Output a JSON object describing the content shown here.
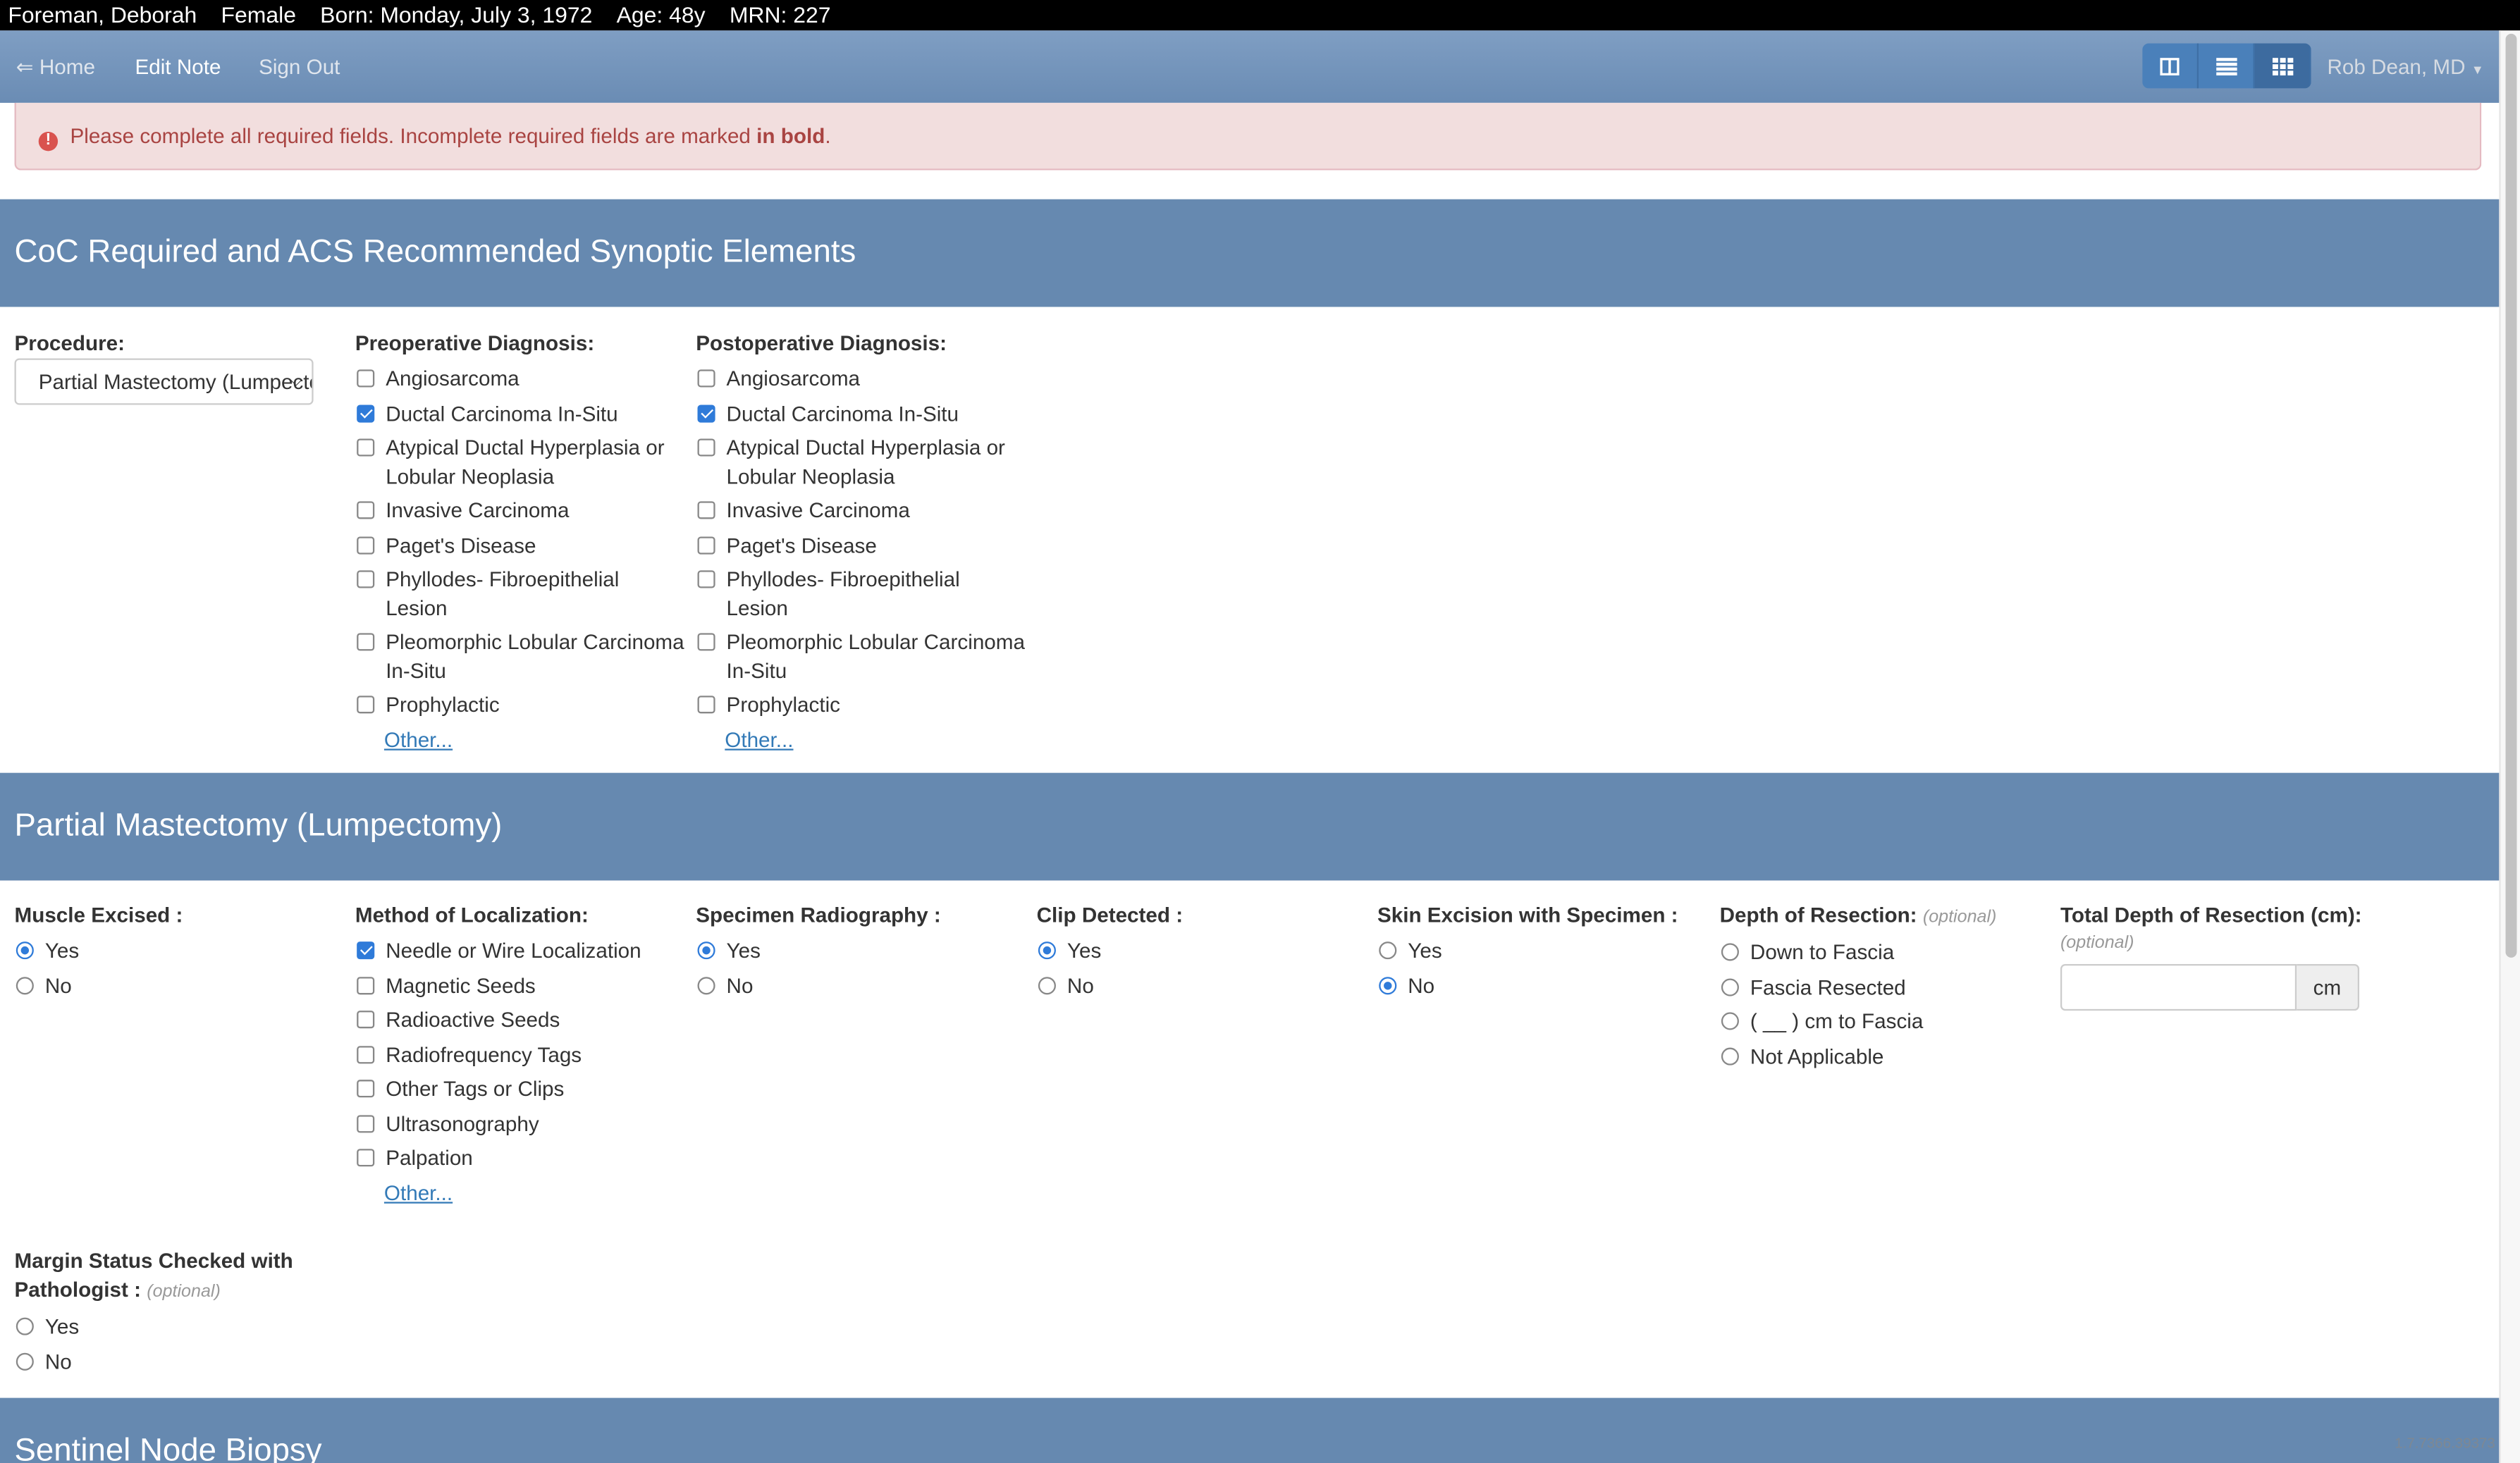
{
  "patient": {
    "name": "Foreman, Deborah",
    "sex": "Female",
    "born": "Born: Monday, July 3, 1972",
    "age": "Age: 48y",
    "mrn": "MRN: 227"
  },
  "nav": {
    "home": "⇐ Home",
    "edit_note": "Edit Note",
    "sign_out": "Sign Out",
    "user": "Rob Dean, MD",
    "views": [
      "two-column-icon",
      "list-icon",
      "grid-icon"
    ],
    "selected_view": "grid-icon"
  },
  "alert": {
    "text": "Please complete all required fields. Incomplete required fields are marked ",
    "bold": "in bold",
    "end": "."
  },
  "colors": {
    "section": "#6689b0",
    "nav": "#7496bd",
    "accent": "#2f7bd9",
    "alert_text": "#a94442"
  },
  "sections": [
    {
      "title": "CoC Required and ACS Recommended Synoptic Elements"
    },
    {
      "title": "Partial Mastectomy (Lumpectomy)"
    },
    {
      "title": "Sentinel Node Biopsy"
    }
  ],
  "procedure": {
    "label": "Procedure:",
    "value": "Partial Mastectomy (Lumpectomy)"
  },
  "fields": [
    {
      "label": "Preoperative Diagnosis:",
      "type": "checkbox",
      "options": [
        {
          "label": "Angiosarcoma",
          "checked": false
        },
        {
          "label": "Ductal Carcinoma In-Situ",
          "checked": true
        },
        {
          "label": "Atypical Ductal Hyperplasia or Lobular Neoplasia",
          "checked": false
        },
        {
          "label": "Invasive Carcinoma",
          "checked": false
        },
        {
          "label": "Paget's Disease",
          "checked": false
        },
        {
          "label": "Phyllodes- Fibroepithelial Lesion",
          "checked": false
        },
        {
          "label": "Pleomorphic Lobular Carcinoma In-Situ",
          "checked": false
        },
        {
          "label": "Prophylactic",
          "checked": false
        }
      ],
      "other": "Other..."
    },
    {
      "label": "Postoperative Diagnosis:",
      "type": "checkbox",
      "options": [
        {
          "label": "Angiosarcoma",
          "checked": false
        },
        {
          "label": "Ductal Carcinoma In-Situ",
          "checked": true
        },
        {
          "label": "Atypical Ductal Hyperplasia or Lobular Neoplasia",
          "checked": false
        },
        {
          "label": "Invasive Carcinoma",
          "checked": false
        },
        {
          "label": "Paget's Disease",
          "checked": false
        },
        {
          "label": "Phyllodes- Fibroepithelial Lesion",
          "checked": false
        },
        {
          "label": "Pleomorphic Lobular Carcinoma In-Situ",
          "checked": false
        },
        {
          "label": "Prophylactic",
          "checked": false
        }
      ],
      "other": "Other..."
    },
    {
      "label": "Muscle Excised :",
      "type": "radio",
      "options": [
        {
          "label": "Yes",
          "checked": true
        },
        {
          "label": "No",
          "checked": false
        }
      ]
    },
    {
      "label": "Method of Localization:",
      "type": "checkbox",
      "options": [
        {
          "label": "Needle or Wire Localization",
          "checked": true
        },
        {
          "label": "Magnetic Seeds",
          "checked": false
        },
        {
          "label": "Radioactive Seeds",
          "checked": false
        },
        {
          "label": "Radiofrequency Tags",
          "checked": false
        },
        {
          "label": "Other Tags or Clips",
          "checked": false
        },
        {
          "label": "Ultrasonography",
          "checked": false
        },
        {
          "label": "Palpation",
          "checked": false
        }
      ],
      "other": "Other..."
    },
    {
      "label": "Specimen Radiography :",
      "type": "radio",
      "options": [
        {
          "label": "Yes",
          "checked": true
        },
        {
          "label": "No",
          "checked": false
        }
      ]
    },
    {
      "label": "Clip Detected :",
      "type": "radio",
      "options": [
        {
          "label": "Yes",
          "checked": true
        },
        {
          "label": "No",
          "checked": false
        }
      ]
    },
    {
      "label": "Skin Excision with Specimen :",
      "type": "radio",
      "options": [
        {
          "label": "Yes",
          "checked": false
        },
        {
          "label": "No",
          "checked": true
        }
      ]
    },
    {
      "label": "Depth of Resection:",
      "optional": "(optional)",
      "type": "radio",
      "options": [
        {
          "label": "Down to Fascia",
          "checked": false
        },
        {
          "label": "Fascia Resected",
          "checked": false
        },
        {
          "label": "( __ ) cm to Fascia",
          "checked": false
        },
        {
          "label": "Not Applicable",
          "checked": false
        }
      ]
    },
    {
      "label": "Total Depth of Resection (cm):",
      "optional_below": "(optional)",
      "type": "input",
      "value": "",
      "unit": "cm"
    },
    {
      "label": "Margin Status Checked with Pathologist :",
      "optional": "(optional)",
      "type": "radio",
      "options": [
        {
          "label": "Yes",
          "checked": false
        },
        {
          "label": "No",
          "checked": false
        }
      ]
    }
  ],
  "version": "1.7.7366.39373"
}
